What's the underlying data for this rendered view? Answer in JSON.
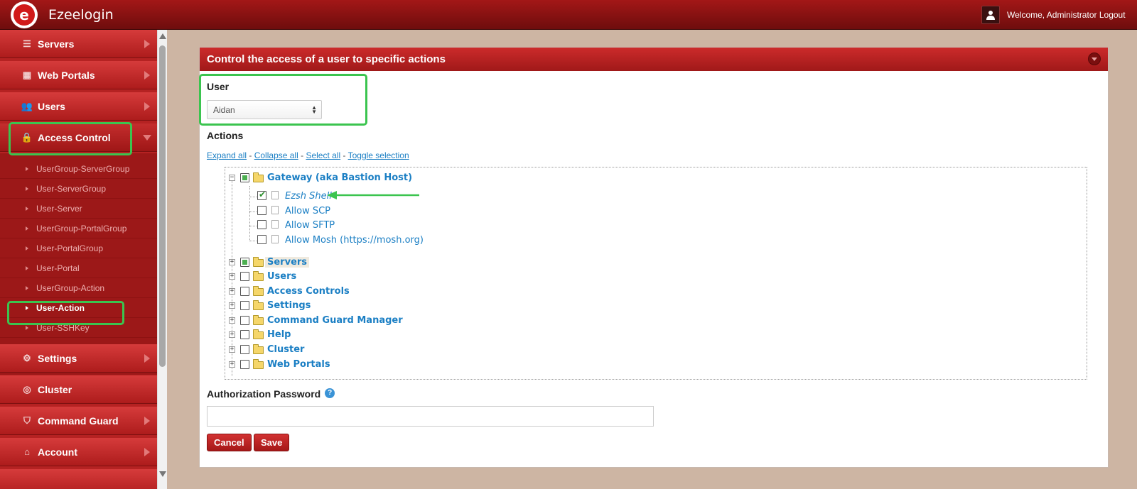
{
  "app": {
    "title": "Ezeelogin",
    "welcome": "Welcome, Administrator",
    "logout": "Logout"
  },
  "sidebar": {
    "items": [
      {
        "label": "Servers",
        "icon": "list-icon"
      },
      {
        "label": "Web Portals",
        "icon": "dashboard-icon"
      },
      {
        "label": "Users",
        "icon": "users-icon"
      },
      {
        "label": "Access Control",
        "icon": "lock-icon"
      },
      {
        "label": "Settings",
        "icon": "gears-icon"
      },
      {
        "label": "Cluster",
        "icon": "globe-icon"
      },
      {
        "label": "Command Guard",
        "icon": "shield-icon"
      },
      {
        "label": "Account",
        "icon": "home-icon"
      }
    ],
    "access_control_sub": [
      "UserGroup-ServerGroup",
      "User-ServerGroup",
      "User-Server",
      "UserGroup-PortalGroup",
      "User-PortalGroup",
      "User-Portal",
      "UserGroup-Action",
      "User-Action",
      "User-SSHKey"
    ]
  },
  "panel": {
    "title": "Control the access of a user to specific actions",
    "user_label": "User",
    "user_value": "Aidan",
    "actions_label": "Actions",
    "links": {
      "expand": "Expand all",
      "collapse": "Collapse all",
      "select": "Select all",
      "toggle": "Toggle selection"
    },
    "tree": {
      "gateway": "Gateway (aka Bastion Host)",
      "gateway_children": [
        "Ezsh Shell",
        "Allow SCP",
        "Allow SFTP",
        "Allow Mosh (https://mosh.org)"
      ],
      "groups": [
        "Servers",
        "Users",
        "Access Controls",
        "Settings",
        "Command Guard Manager",
        "Help",
        "Cluster",
        "Web Portals"
      ]
    },
    "auth_label": "Authorization Password",
    "cancel": "Cancel",
    "save": "Save"
  },
  "colors": {
    "brand": "#b52222",
    "highlight": "#3bc44f",
    "link": "#1b7fc4"
  }
}
